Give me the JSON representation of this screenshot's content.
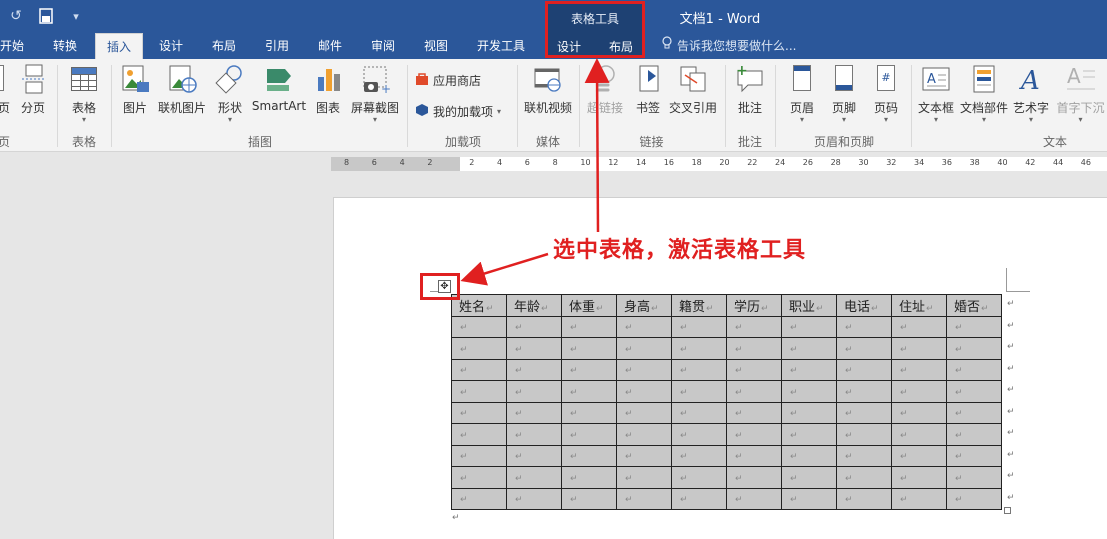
{
  "titlebar": {
    "doc_title": "文档1 - Word",
    "qat": [
      "undo-icon",
      "save-icon",
      "customize-qat-icon"
    ],
    "bg_color": "#2b579a"
  },
  "table_tools": {
    "label": "表格工具",
    "tabs": [
      "设计",
      "布局"
    ],
    "highlight_color": "#e02020"
  },
  "tabs": [
    "开始",
    "转换",
    "插入",
    "设计",
    "布局",
    "引用",
    "邮件",
    "审阅",
    "视图",
    "开发工具"
  ],
  "active_tab": "插入",
  "tell_me": "告诉我您想要做什么...",
  "ribbon": {
    "pages": {
      "page": "页",
      "page_break": "分页"
    },
    "tables": {
      "table": "表格",
      "group": "表格"
    },
    "illustrations": {
      "items": [
        "图片",
        "联机图片",
        "形状",
        "SmartArt",
        "图表",
        "屏幕截图"
      ],
      "group": "插图"
    },
    "addins": {
      "store": "应用商店",
      "my_addins": "我的加载项",
      "group": "加载项"
    },
    "media": {
      "online_video": "联机视频",
      "group": "媒体"
    },
    "links": {
      "items": [
        "超链接",
        "书签",
        "交叉引用"
      ],
      "group": "链接"
    },
    "comments": {
      "comment": "批注",
      "group": "批注"
    },
    "header_footer": {
      "items": [
        "页眉",
        "页脚",
        "页码"
      ],
      "group": "页眉和页脚"
    },
    "text": {
      "items": [
        "文本框",
        "文档部件",
        "艺术字",
        "首字下沉"
      ],
      "group": "文本"
    }
  },
  "ruler": {
    "ticks": [
      "8",
      "6",
      "4",
      "2",
      "2",
      "4",
      "6",
      "8",
      "10",
      "12",
      "14",
      "16",
      "18",
      "20",
      "22",
      "24",
      "26",
      "28",
      "30",
      "32",
      "34",
      "36",
      "38",
      "40",
      "42",
      "44",
      "46"
    ]
  },
  "document": {
    "table": {
      "headers": [
        "姓名",
        "年龄",
        "体重",
        "身高",
        "籍贯",
        "学历",
        "职业",
        "电话",
        "住址",
        "婚否"
      ],
      "empty_rows": 9,
      "cell_mark": "↵",
      "row_mark": "↵",
      "fill_color": "#c8c8c8"
    },
    "move_handle_glyph": "✥",
    "paragraph_mark": "↵"
  },
  "annotation": {
    "text": "选中表格，激活表格工具",
    "color": "#e02020"
  }
}
